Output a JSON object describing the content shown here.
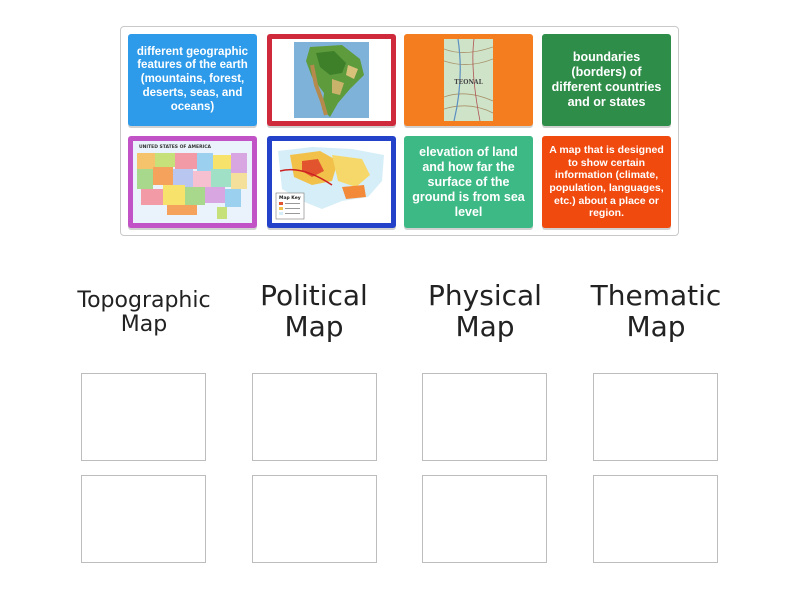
{
  "cards": [
    {
      "type": "text",
      "text": "different geographic features of the earth (mountains, forest, deserts, seas, and oceans)",
      "color": "#2e9bea"
    },
    {
      "type": "image",
      "icon": "south-america-physical-map-image",
      "color": "#cf2a3b"
    },
    {
      "type": "image",
      "icon": "topographic-contour-map-image",
      "color": "#f47d20",
      "map_label": "TEONAL"
    },
    {
      "type": "text",
      "text": "boundaries (borders) of different countries and or states",
      "color": "#2f8d4a"
    },
    {
      "type": "image",
      "icon": "usa-political-map-image",
      "color": "#c253c7",
      "map_label": "UNITED STATES OF AMERICA"
    },
    {
      "type": "image",
      "icon": "usa-thematic-map-image",
      "color": "#2442c9",
      "map_label": "Map Key"
    },
    {
      "type": "text",
      "text": "elevation of land and how far the surface of the ground is from sea level",
      "color": "#3cb985"
    },
    {
      "type": "text",
      "text": "A map that is designed to show certain information (climate, population, languages, etc.) about a place or region.",
      "color": "#f04a0f"
    }
  ],
  "categories": [
    {
      "title": "Topographic Map"
    },
    {
      "title": "Political Map"
    },
    {
      "title": "Physical Map"
    },
    {
      "title": "Thematic Map"
    }
  ]
}
